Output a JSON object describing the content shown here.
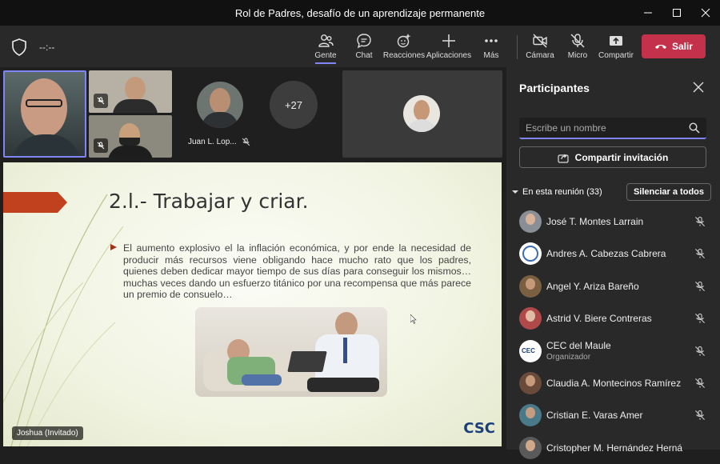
{
  "window": {
    "title": "Rol de Padres, desafío de un aprendizaje permanente"
  },
  "toolbar": {
    "timer": "--:--",
    "people": "Gente",
    "chat": "Chat",
    "reactions": "Reacciones",
    "apps": "Aplicaciones",
    "more": "Más",
    "camera": "Cámara",
    "mic": "Micro",
    "share": "Compartir",
    "leave": "Salir"
  },
  "stage": {
    "tile_name": "Juan L. Lop...",
    "overflow_count": "+27",
    "presenter_tag": "Joshua (Invitado)"
  },
  "slide": {
    "title": "2.l.- Trabajar y criar.",
    "body": "El aumento explosivo el la inflación económica, y por ende la necesidad de producir más recursos viene obligando hace mucho rato que los padres, quienes deben dedicar mayor tiempo de sus días para conseguir los mismos… muchas veces dando un esfuerzo titánico por una recompensa que más parece un premio de consuelo…",
    "logo": "CSC"
  },
  "participants": {
    "title": "Participantes",
    "search_placeholder": "Escribe un nombre",
    "share_invite": "Compartir invitación",
    "section_label": "En esta reunión (33)",
    "mute_all": "Silenciar a todos",
    "list": [
      {
        "name": "José T. Montes Larrain",
        "role": "",
        "avatar_color": "#8a8f96"
      },
      {
        "name": "Andres A. Cabezas Cabrera",
        "role": "",
        "avatar_color": "#3d6db4"
      },
      {
        "name": "Angel Y. Ariza Bareño",
        "role": "",
        "avatar_color": "#7a6040"
      },
      {
        "name": "Astrid V. Biere Contreras",
        "role": "",
        "avatar_color": "#b04a4a"
      },
      {
        "name": "CEC del Maule",
        "role": "Organizador",
        "avatar_color": "#ffffff"
      },
      {
        "name": "Claudia A. Montecinos Ramírez",
        "role": "",
        "avatar_color": "#6a4a3a"
      },
      {
        "name": "Cristian E. Varas Amer",
        "role": "",
        "avatar_color": "#4a7a8a"
      },
      {
        "name": "Cristopher M. Hernández Herná",
        "role": "",
        "avatar_color": "#5a5a5a"
      }
    ]
  },
  "colors": {
    "accent": "#7f85f5",
    "leave": "#c4314b",
    "slide_arrow": "#c1411f"
  }
}
